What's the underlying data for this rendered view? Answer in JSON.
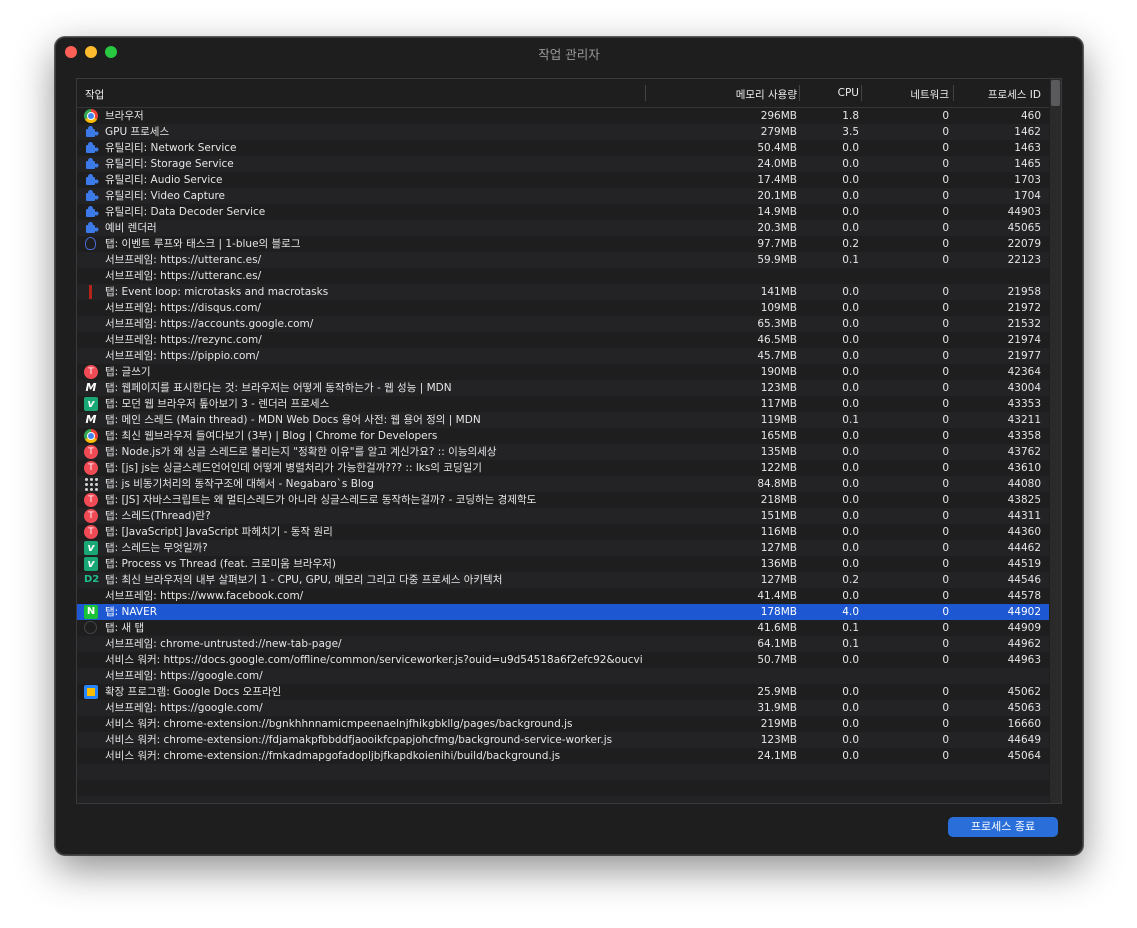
{
  "window": {
    "title": "작업 관리자"
  },
  "table": {
    "columns": {
      "task": "작업",
      "memory": "메모리 사용량",
      "cpu": "CPU",
      "network": "네트워크",
      "pid": "프로세스 ID"
    },
    "rows": [
      {
        "icon": "chrome-icon",
        "name": "브라우저",
        "memory": "296MB",
        "cpu": "1.8",
        "network": "0",
        "pid": "460"
      },
      {
        "icon": "puzzle-icon",
        "name": "GPU 프로세스",
        "memory": "279MB",
        "cpu": "3.5",
        "network": "0",
        "pid": "1462"
      },
      {
        "icon": "puzzle-icon",
        "name": "유틸리티: Network Service",
        "memory": "50.4MB",
        "cpu": "0.0",
        "network": "0",
        "pid": "1463"
      },
      {
        "icon": "puzzle-icon",
        "name": "유틸리티: Storage Service",
        "memory": "24.0MB",
        "cpu": "0.0",
        "network": "0",
        "pid": "1465"
      },
      {
        "icon": "puzzle-icon",
        "name": "유틸리티: Audio Service",
        "memory": "17.4MB",
        "cpu": "0.0",
        "network": "0",
        "pid": "1703"
      },
      {
        "icon": "puzzle-icon",
        "name": "유틸리티: Video Capture",
        "memory": "20.1MB",
        "cpu": "0.0",
        "network": "0",
        "pid": "1704"
      },
      {
        "icon": "puzzle-icon",
        "name": "유틸리티: Data Decoder Service",
        "memory": "14.9MB",
        "cpu": "0.0",
        "network": "0",
        "pid": "44903"
      },
      {
        "icon": "puzzle-icon",
        "name": "예비 렌더러",
        "memory": "20.3MB",
        "cpu": "0.0",
        "network": "0",
        "pid": "45065"
      },
      {
        "icon": "rocket-icon",
        "name": "탭: 이벤트 루프와 태스크 | 1-blue의 블로그",
        "memory": "97.7MB",
        "cpu": "0.2",
        "network": "0",
        "pid": "22079"
      },
      {
        "icon": "",
        "name": "서브프레임: https://utteranc.es/",
        "memory": "59.9MB",
        "cpu": "0.1",
        "network": "0",
        "pid": "22123"
      },
      {
        "icon": "",
        "name": "서브프레임: https://utteranc.es/",
        "memory": "",
        "cpu": "",
        "network": "",
        "pid": ""
      },
      {
        "icon": "red-figure-icon",
        "name": "탭: Event loop: microtasks and macrotasks",
        "memory": "141MB",
        "cpu": "0.0",
        "network": "0",
        "pid": "21958"
      },
      {
        "icon": "",
        "name": "서브프레임: https://disqus.com/",
        "memory": "109MB",
        "cpu": "0.0",
        "network": "0",
        "pid": "21972"
      },
      {
        "icon": "",
        "name": "서브프레임: https://accounts.google.com/",
        "memory": "65.3MB",
        "cpu": "0.0",
        "network": "0",
        "pid": "21532"
      },
      {
        "icon": "",
        "name": "서브프레임: https://rezync.com/",
        "memory": "46.5MB",
        "cpu": "0.0",
        "network": "0",
        "pid": "21974"
      },
      {
        "icon": "",
        "name": "서브프레임: https://pippio.com/",
        "memory": "45.7MB",
        "cpu": "0.0",
        "network": "0",
        "pid": "21977"
      },
      {
        "icon": "tistory-icon",
        "name": "탭: 글쓰기",
        "memory": "190MB",
        "cpu": "0.0",
        "network": "0",
        "pid": "42364"
      },
      {
        "icon": "mdn-icon",
        "name": "탭: 웹페이지를 표시한다는 것: 브라우저는 어떻게 동작하는가 - 웹 성능 | MDN",
        "memory": "123MB",
        "cpu": "0.0",
        "network": "0",
        "pid": "43004"
      },
      {
        "icon": "velog-icon",
        "name": "탭: 모던 웹 브라우저 톺아보기 3 - 렌더러 프로세스",
        "memory": "117MB",
        "cpu": "0.0",
        "network": "0",
        "pid": "43353"
      },
      {
        "icon": "mdn-icon",
        "name": "탭: 메인 스레드 (Main thread) - MDN Web Docs 용어 사전: 웹 용어 정의 | MDN",
        "memory": "119MB",
        "cpu": "0.1",
        "network": "0",
        "pid": "43211"
      },
      {
        "icon": "chrome-icon",
        "name": "탭: 최신 웹브라우저 들여다보기 (3부)  |  Blog  |  Chrome for Developers",
        "memory": "165MB",
        "cpu": "0.0",
        "network": "0",
        "pid": "43358"
      },
      {
        "icon": "tistory-icon",
        "name": "탭: Node.js가 왜 싱글 스레드로 불리는지 \"정확한 이유\"를 알고 계신가요? :: 이능의세상",
        "memory": "135MB",
        "cpu": "0.0",
        "network": "0",
        "pid": "43762"
      },
      {
        "icon": "tistory-icon",
        "name": "탭: [js] js는 싱글스레드언어인데 어떻게 병렬처리가 가능한걸까??? :: lks의 코딩일기",
        "memory": "122MB",
        "cpu": "0.0",
        "network": "0",
        "pid": "43610"
      },
      {
        "icon": "dots-icon",
        "name": "탭: js 비동기처리의 동작구조에 대해서 - Negabaro`s Blog",
        "memory": "84.8MB",
        "cpu": "0.0",
        "network": "0",
        "pid": "44080"
      },
      {
        "icon": "tistory-icon",
        "name": "탭: [JS] 자바스크립트는 왜 멀티스레드가 아니라 싱글스레드로 동작하는걸까? - 코딩하는 경제학도",
        "memory": "218MB",
        "cpu": "0.0",
        "network": "0",
        "pid": "43825"
      },
      {
        "icon": "tistory-icon",
        "name": "탭: 스레드(Thread)란?",
        "memory": "151MB",
        "cpu": "0.0",
        "network": "0",
        "pid": "44311"
      },
      {
        "icon": "tistory-icon",
        "name": "탭: [JavaScript] JavaScript 파헤치기 - 동작 원리",
        "memory": "116MB",
        "cpu": "0.0",
        "network": "0",
        "pid": "44360"
      },
      {
        "icon": "velog-icon",
        "name": "탭: 스레드는 무엇일까?",
        "memory": "127MB",
        "cpu": "0.0",
        "network": "0",
        "pid": "44462"
      },
      {
        "icon": "velog-icon",
        "name": "탭: Process vs Thread (feat. 크로미움 브라우저)",
        "memory": "136MB",
        "cpu": "0.0",
        "network": "0",
        "pid": "44519"
      },
      {
        "icon": "d2-icon",
        "name": "탭: 최신 브라우저의 내부 살펴보기 1 - CPU, GPU, 메모리 그리고 다중 프로세스 아키텍처",
        "memory": "127MB",
        "cpu": "0.2",
        "network": "0",
        "pid": "44546"
      },
      {
        "icon": "",
        "name": "서브프레임: https://www.facebook.com/",
        "memory": "41.4MB",
        "cpu": "0.0",
        "network": "0",
        "pid": "44578"
      },
      {
        "icon": "naver-icon",
        "name": "탭: NAVER",
        "memory": "178MB",
        "cpu": "4.0",
        "network": "0",
        "pid": "44902",
        "selected": true
      },
      {
        "icon": "new-tab-icon",
        "name": "탭: 새 탭",
        "memory": "41.6MB",
        "cpu": "0.1",
        "network": "0",
        "pid": "44909"
      },
      {
        "icon": "",
        "name": "서브프레임: chrome-untrusted://new-tab-page/",
        "memory": "64.1MB",
        "cpu": "0.1",
        "network": "0",
        "pid": "44962"
      },
      {
        "icon": "",
        "name": "서비스 워커: https://docs.google.com/offline/common/serviceworker.js?ouid=u9d54518a6f2efc92&oucvi",
        "memory": "50.7MB",
        "cpu": "0.0",
        "network": "0",
        "pid": "44963"
      },
      {
        "icon": "",
        "name": "서브프레임: https://google.com/",
        "memory": "",
        "cpu": "",
        "network": "",
        "pid": ""
      },
      {
        "icon": "google-docs-icon",
        "name": "확장 프로그램: Google Docs 오프라인",
        "memory": "25.9MB",
        "cpu": "0.0",
        "network": "0",
        "pid": "45062"
      },
      {
        "icon": "",
        "name": "서브프레임: https://google.com/",
        "memory": "31.9MB",
        "cpu": "0.0",
        "network": "0",
        "pid": "45063"
      },
      {
        "icon": "",
        "name": "서비스 워커: chrome-extension://bgnkhhnnamicmpeenaelnjfhikgbkllg/pages/background.js",
        "memory": "219MB",
        "cpu": "0.0",
        "network": "0",
        "pid": "16660"
      },
      {
        "icon": "",
        "name": "서비스 워커: chrome-extension://fdjamakpfbbddfjaooikfcpapjohcfmg/background-service-worker.js",
        "memory": "123MB",
        "cpu": "0.0",
        "network": "0",
        "pid": "44649"
      },
      {
        "icon": "",
        "name": "서비스 워커: chrome-extension://fmkadmapgofadopljbjfkapdkoienihi/build/background.js",
        "memory": "24.1MB",
        "cpu": "0.0",
        "network": "0",
        "pid": "45064"
      }
    ],
    "blank_rows": 3
  },
  "footer": {
    "end_process_label": "프로세스 종료"
  }
}
